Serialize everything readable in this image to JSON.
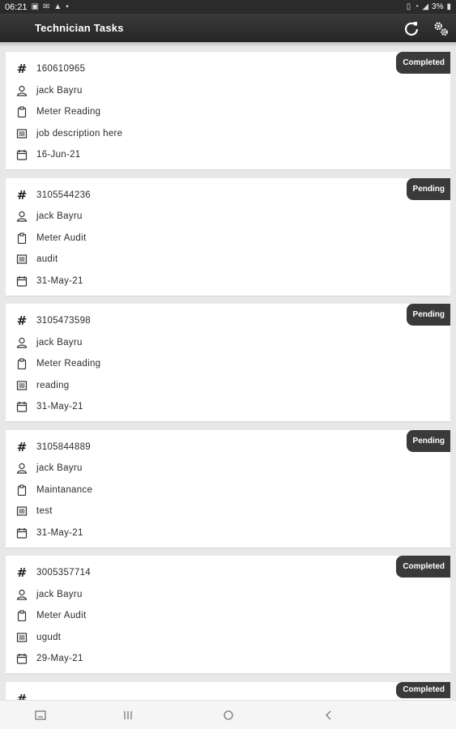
{
  "status_bar": {
    "time": "06:21",
    "battery": "3%"
  },
  "app_bar": {
    "title": "Technician Tasks",
    "refresh_icon": "refresh-icon",
    "settings_icon": "gears-icon"
  },
  "tasks": [
    {
      "id": "160610965",
      "technician": "jack Bayru",
      "type": "Meter Reading",
      "description": "job description here",
      "date": "16-Jun-21",
      "status": "Completed"
    },
    {
      "id": "3105544236",
      "technician": "jack Bayru",
      "type": "Meter Audit",
      "description": "audit",
      "date": "31-May-21",
      "status": "Pending"
    },
    {
      "id": "3105473598",
      "technician": "jack Bayru",
      "type": "Meter Reading",
      "description": "reading",
      "date": "31-May-21",
      "status": "Pending"
    },
    {
      "id": "3105844889",
      "technician": "jack Bayru",
      "type": "Maintanance",
      "description": "test",
      "date": "31-May-21",
      "status": "Pending"
    },
    {
      "id": "3005357714",
      "technician": "jack Bayru",
      "type": "Meter Audit",
      "description": "ugudt",
      "date": "29-May-21",
      "status": "Completed"
    }
  ],
  "partial_task": {
    "status": "Completed"
  },
  "colors": {
    "app_bar": "#2b2b2b",
    "badge": "#3a3a3a",
    "background": "#e8e8e8"
  }
}
